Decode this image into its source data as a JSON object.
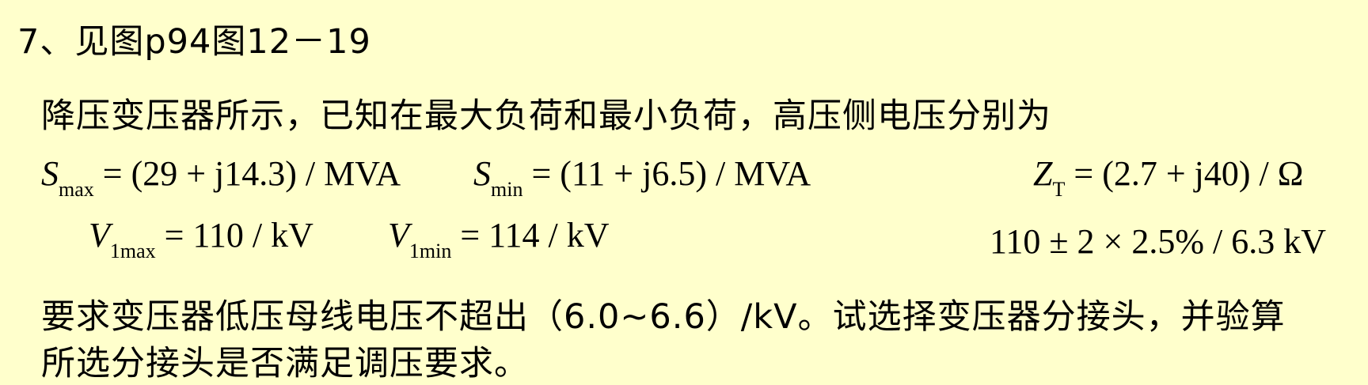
{
  "problem": {
    "number": "7、见图p94图12－19",
    "intro": "降压变压器所示，已知在最大负荷和最小负荷，高压侧电压分别为",
    "requirement_line1": "要求变压器低压母线电压不超出（6.0~6.6）/kV。试选择变压器分接头，并验算",
    "requirement_line2": "所选分接头是否满足调压要求。"
  },
  "equations": {
    "smax": {
      "symbol": "S",
      "sub": "max",
      "rhs": "= (29 + j14.3) / MVA"
    },
    "smin": {
      "symbol": "S",
      "sub": "min",
      "rhs": "= (11 + j6.5) / MVA"
    },
    "zt": {
      "symbol": "Z",
      "sub": "T",
      "rhs": "= (2.7 + j40) / Ω"
    },
    "v1max": {
      "symbol": "V",
      "sub": "1max",
      "rhs": "= 110 / kV"
    },
    "v1min": {
      "symbol": "V",
      "sub": "1min",
      "rhs": "= 114 / kV"
    },
    "tap": "110 ± 2 × 2.5% / 6.3 kV"
  }
}
